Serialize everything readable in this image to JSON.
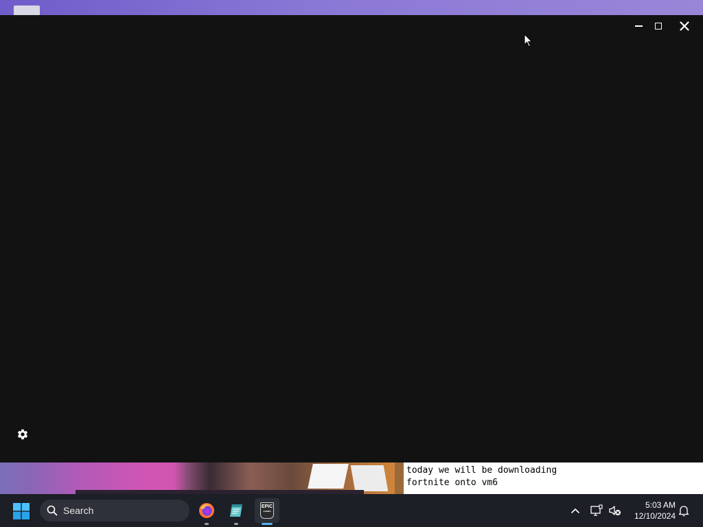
{
  "desktop": {
    "wallpaper_color": "#7c6ad0"
  },
  "launcher": {
    "background": "#121212",
    "controls": {
      "minimize_icon": "minimize-icon",
      "maximize_icon": "maximize-icon",
      "close_icon": "close-icon"
    },
    "settings_icon": "gear-icon"
  },
  "stream_overlay": {
    "caption_line1": "today we will be downloading",
    "caption_line2": "fortnite onto vm6"
  },
  "taskbar": {
    "start_icon": "windows-start-icon",
    "search": {
      "label": "Search"
    },
    "apps": [
      {
        "name": "Firefox",
        "icon": "firefox-icon",
        "running": true
      },
      {
        "name": "Notepad",
        "icon": "notepad-icon",
        "running": true
      },
      {
        "name": "Epic Games Launcher",
        "icon": "epic-games-icon",
        "running": true,
        "active": true,
        "logo_text": "EPIC",
        "logo_subtext": "GAMES"
      }
    ],
    "tray": {
      "chevron_icon": "chevron-up-icon",
      "network_icon": "network-icon",
      "volume_icon": "volume-muted-icon",
      "notification_icon": "bell-icon"
    },
    "clock": {
      "time": "5:03 AM",
      "date": "12/10/2024"
    },
    "accent_color": "#5ab0f0"
  }
}
